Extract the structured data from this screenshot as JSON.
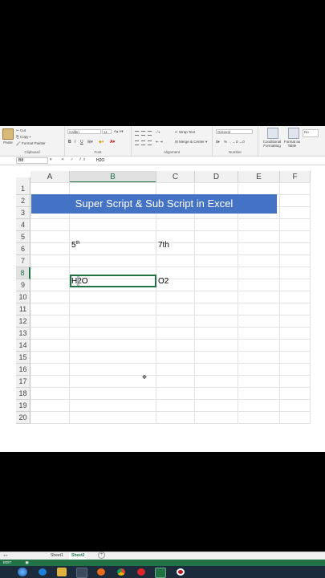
{
  "ribbon": {
    "clipboard": {
      "paste_label": "Paste",
      "cut_label": "Cut",
      "copy_label": "Copy",
      "format_painter_label": "Format Painter",
      "group_label": "Clipboard"
    },
    "font": {
      "font_name": "Calibri",
      "font_size": "11",
      "bold_label": "B",
      "italic_label": "I",
      "underline_label": "U",
      "font_color_label": "A",
      "group_label": "Font"
    },
    "alignment": {
      "wrap_text_label": "Wrap Text",
      "merge_center_label": "Merge & Center",
      "group_label": "Alignment"
    },
    "number": {
      "format_value": "General",
      "currency_label": "$",
      "percent_label": "%",
      "group_label": "Number"
    },
    "styles": {
      "conditional_label": "Conditional Formatting",
      "format_as_table_label": "Format as Table",
      "normal_label": "No"
    }
  },
  "formula_bar": {
    "name_box": "B8",
    "cancel": "✕",
    "confirm": "✓",
    "fx": "fx",
    "value": "H2O"
  },
  "columns": [
    "A",
    "B",
    "C",
    "D",
    "E",
    "F"
  ],
  "rows": [
    "1",
    "2",
    "3",
    "4",
    "5",
    "6",
    "7",
    "8",
    "9",
    "10",
    "11",
    "12",
    "13",
    "14",
    "15",
    "16",
    "17",
    "18",
    "19",
    "20"
  ],
  "cells": {
    "banner": "Super Script & Sub Script in Excel",
    "b5_base": "5",
    "b5_sup": "th",
    "c5": "7th",
    "b8": "H2O",
    "c8": "O2"
  },
  "sheets": [
    "Sheet1",
    "Sheet2"
  ],
  "add_sheet": "+",
  "status": {
    "mode": "EDIT"
  },
  "colors": {
    "excel_green": "#217346",
    "banner_blue": "#4472c4",
    "taskbar": "#1b2b3c"
  }
}
